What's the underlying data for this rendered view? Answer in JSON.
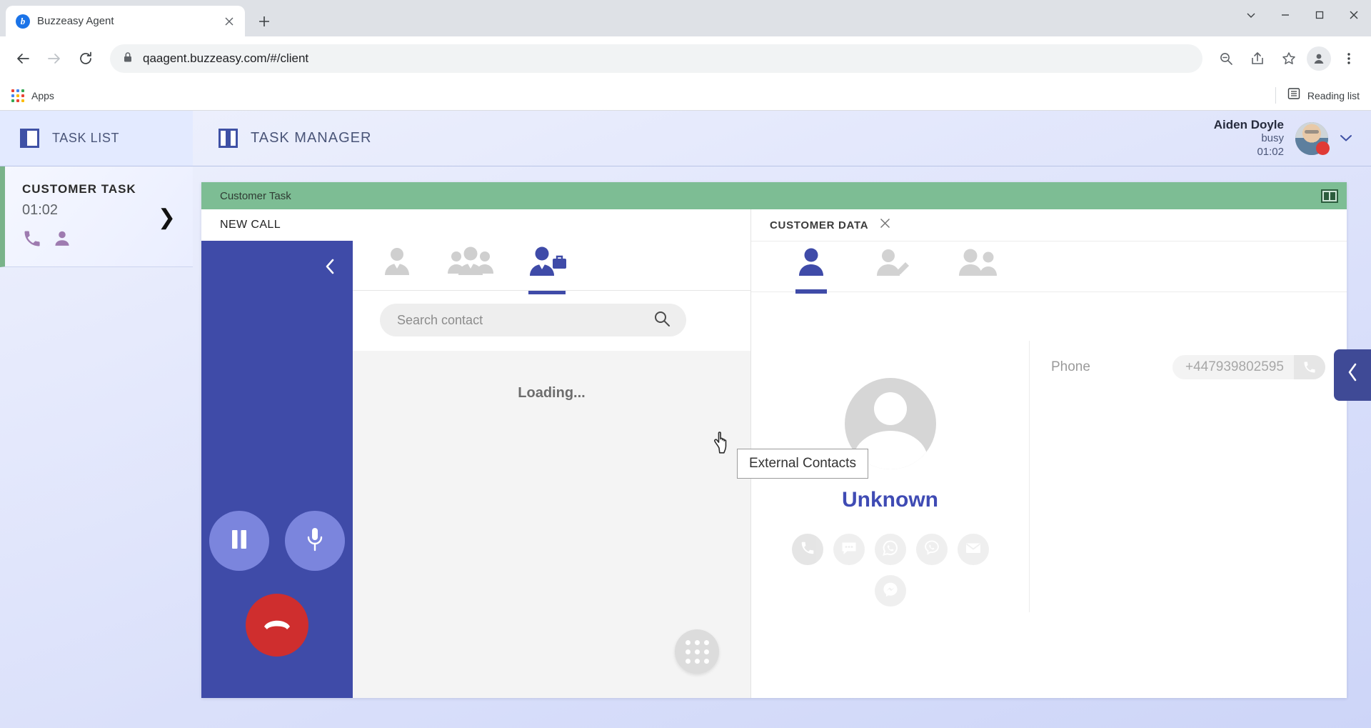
{
  "browser": {
    "tab": {
      "title": "Buzzeasy Agent",
      "favicon_letter": "b",
      "close_icon": "close-icon"
    },
    "new_tab_label": "+",
    "window_controls": {
      "minimize": "–",
      "maximize": "□",
      "close": "✕",
      "chevron": "⌄"
    },
    "address": {
      "url": "qaagent.buzzeasy.com/#/client",
      "lock_icon": "lock-icon"
    },
    "toolbar_icons": [
      "zoom-out-icon",
      "share-icon",
      "bookmark-star-icon",
      "profile-icon",
      "kebab-menu-icon"
    ],
    "bookmarks": {
      "apps_label": "Apps",
      "reading_list_label": "Reading list"
    }
  },
  "tasklist": {
    "header_title": "TASK LIST",
    "task": {
      "name": "CUSTOMER TASK",
      "timer": "01:02",
      "icons": [
        "phone-icon",
        "person-icon"
      ],
      "chevron": "❯"
    }
  },
  "main_header": {
    "title": "TASK MANAGER",
    "user": {
      "name": "Aiden Doyle",
      "status": "busy",
      "timer": "01:02",
      "status_color": "#e03a36"
    },
    "caret": "⌄"
  },
  "work": {
    "topbar_label": "Customer Task",
    "topbar_color": "#7dbd94",
    "split_icon": "split-view-icon"
  },
  "call": {
    "section_label": "NEW CALL",
    "collapse_icon": "‹",
    "controls": [
      {
        "name": "pause-button",
        "icon": "pause-icon"
      },
      {
        "name": "mute-button",
        "icon": "microphone-icon"
      }
    ],
    "hangup": {
      "name": "hangup-button",
      "icon": "hangup-phone-icon"
    },
    "panel_color": "#3f4ba8"
  },
  "contacts": {
    "tabs": [
      {
        "name": "agents",
        "icon": "person-icon",
        "active": false
      },
      {
        "name": "groups",
        "icon": "group-icon",
        "active": false
      },
      {
        "name": "external-contacts",
        "icon": "business-person-icon",
        "active": true
      }
    ],
    "tooltip": "External Contacts",
    "search": {
      "placeholder": "Search contact",
      "value": "",
      "icon": "search-icon"
    },
    "status": "Loading...",
    "dialpad_icon": "dialpad-icon"
  },
  "customer_data": {
    "title": "CUSTOMER DATA",
    "close_icon": "✕",
    "tabs": [
      {
        "name": "profile",
        "icon": "person-icon",
        "active": true
      },
      {
        "name": "edit-profile",
        "icon": "person-edit-icon",
        "active": false
      },
      {
        "name": "related-contacts",
        "icon": "group-icon",
        "active": false
      }
    ],
    "customer": {
      "name": "Unknown",
      "avatar_icon": "default-avatar-icon",
      "channels": [
        {
          "name": "phone",
          "icon": "phone-icon"
        },
        {
          "name": "sms-chat",
          "icon": "chat-bubble-icon"
        },
        {
          "name": "whatsapp",
          "icon": "whatsapp-icon"
        },
        {
          "name": "viber",
          "icon": "viber-icon"
        },
        {
          "name": "email",
          "icon": "envelope-icon"
        },
        {
          "name": "messenger",
          "icon": "messenger-icon"
        }
      ]
    },
    "fields": [
      {
        "label": "Phone",
        "value": "+447939802595",
        "action_icon": "call-icon"
      }
    ]
  },
  "right_panel_toggle": {
    "icon": "‹",
    "color": "#3f4a96"
  }
}
